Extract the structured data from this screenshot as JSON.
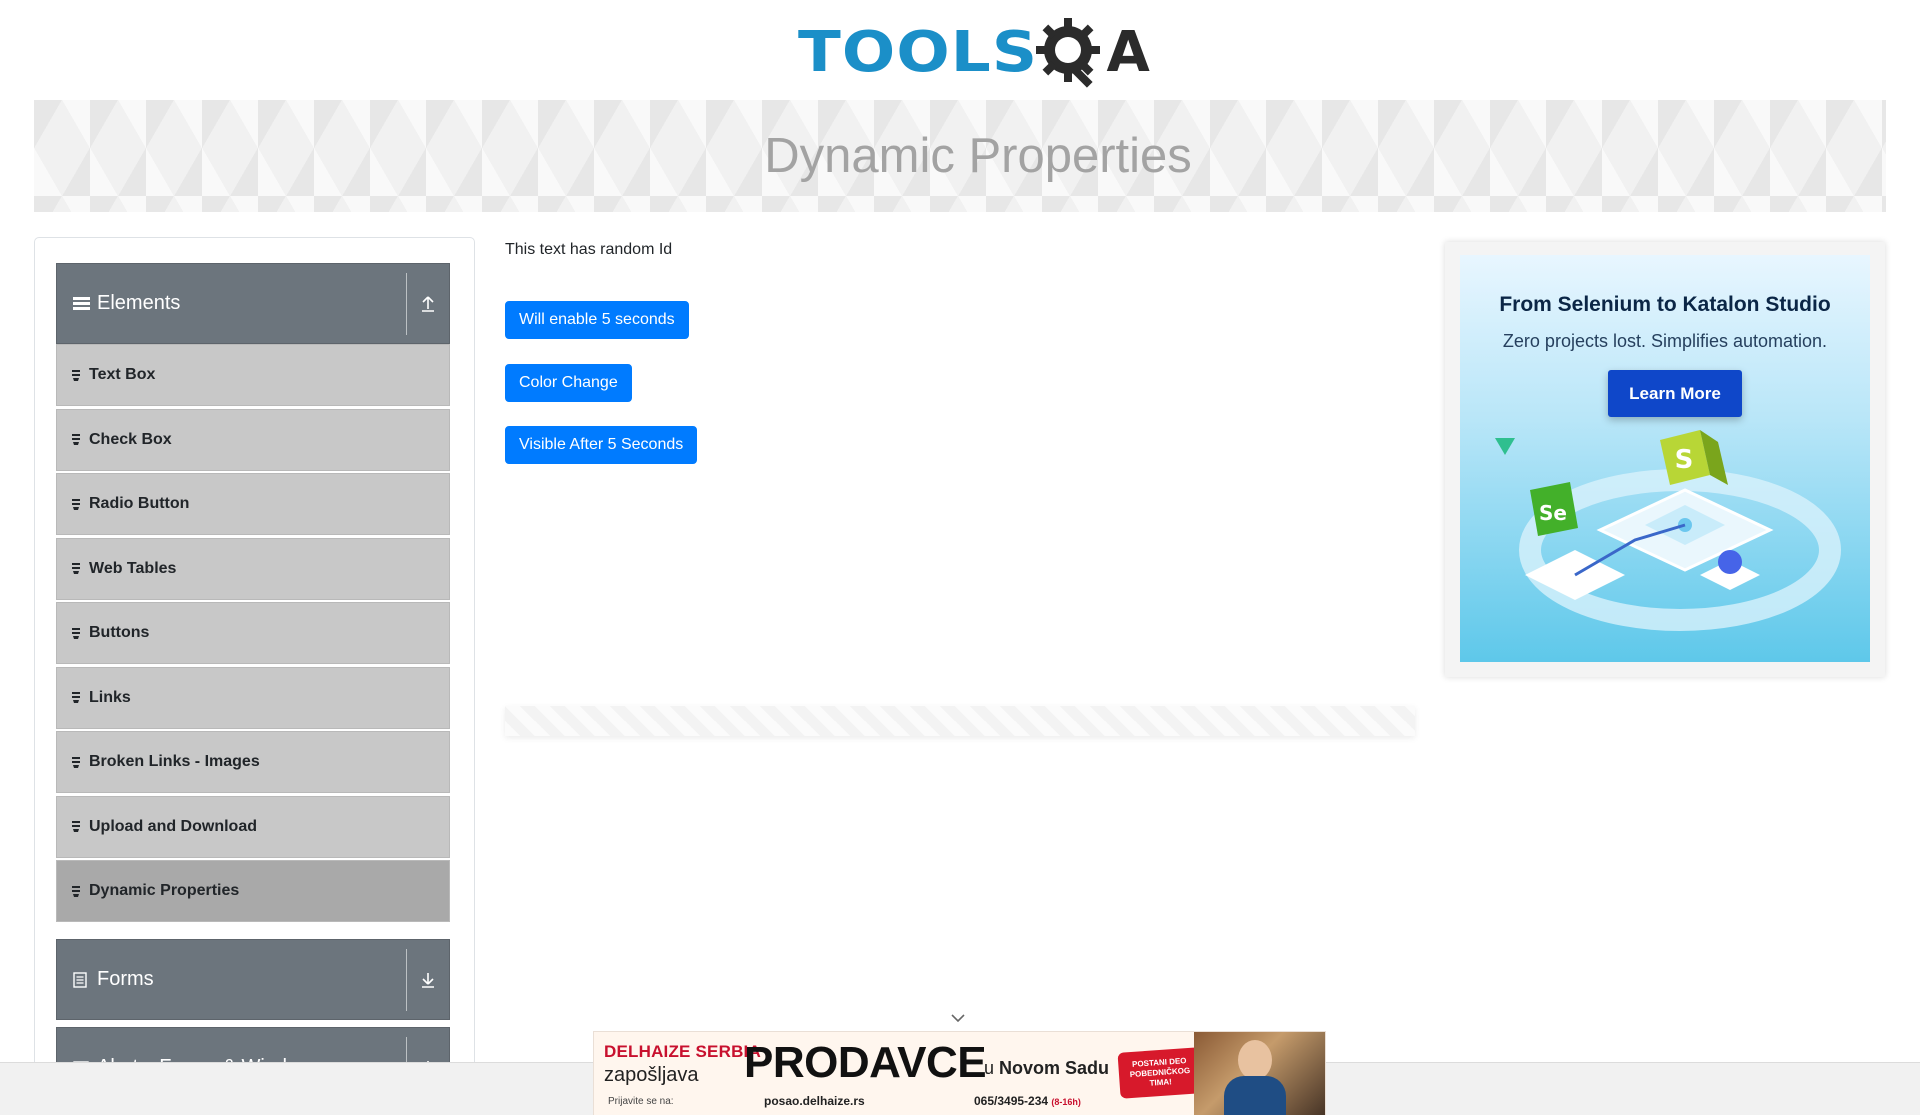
{
  "header": {
    "logo_text_left": "TOOLS",
    "logo_text_right": "A"
  },
  "banner": {
    "title": "Dynamic Properties"
  },
  "sidebar": {
    "groups": [
      {
        "label": "Elements",
        "icon": "hamburger-icon",
        "toggle_icon": "collapse-up-icon",
        "expanded": true,
        "items": [
          {
            "label": "Text Box"
          },
          {
            "label": "Check Box"
          },
          {
            "label": "Radio Button"
          },
          {
            "label": "Web Tables"
          },
          {
            "label": "Buttons"
          },
          {
            "label": "Links"
          },
          {
            "label": "Broken Links - Images"
          },
          {
            "label": "Upload and Download"
          },
          {
            "label": "Dynamic Properties",
            "active": true
          }
        ]
      },
      {
        "label": "Forms",
        "icon": "form-icon",
        "toggle_icon": "expand-down-icon",
        "expanded": false
      },
      {
        "label": "Alerts, Frame & Windows",
        "icon": "window-icon",
        "toggle_icon": "expand-down-icon",
        "expanded": false
      }
    ]
  },
  "main": {
    "random_id_text": "This text has random Id",
    "buttons": {
      "enable_after": "Will enable 5 seconds",
      "color_change": "Color Change",
      "visible_after": "Visible After 5 Seconds"
    }
  },
  "side_ad": {
    "title": "From Selenium to Katalon Studio",
    "subtitle": "Zero projects lost. Simplifies automation.",
    "cta": "Learn More",
    "badge_s": "S",
    "badge_se": "Se"
  },
  "bottom_ad": {
    "brand": "DELHAIZE SERBIA",
    "brand_sub": "zapošljava",
    "apply": "Prijavite se na:",
    "headline": "PRODAVCE",
    "city_prefix": "u",
    "city": "Novom Sadu",
    "site": "posao.delhaize.rs",
    "phone": "065/3495-234",
    "hours": "(8-16h)",
    "badge": "POSTANI DEO POBEDNIČKOG TIMA!"
  },
  "colors": {
    "primary_button": "#007bff",
    "sidebar_header": "#6c757d",
    "menu_item": "#c8c8c8",
    "menu_item_active": "#a9a9a9",
    "logo_blue": "#1b8fc8",
    "banner_title": "#a3a3a3"
  }
}
